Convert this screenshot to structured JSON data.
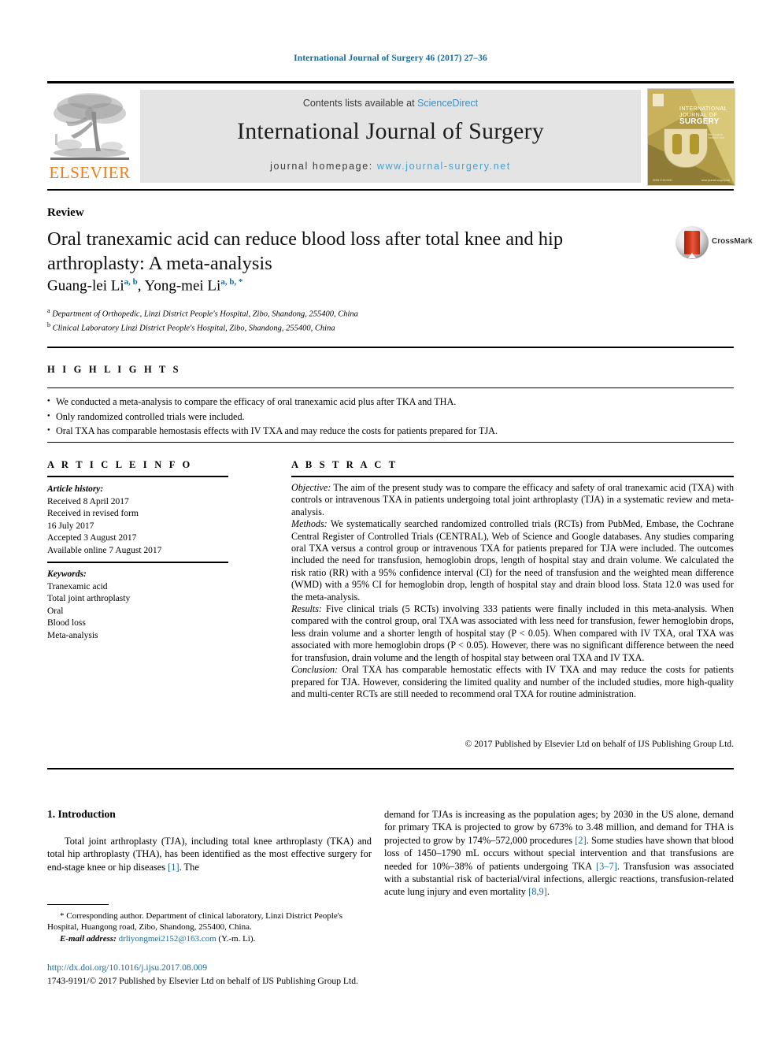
{
  "running_head": "International Journal of Surgery 46 (2017) 27–36",
  "masthead": {
    "contents_prefix": "Contents lists available at ",
    "contents_link": "ScienceDirect",
    "journal_title": "International Journal of Surgery",
    "homepage_prefix": "journal homepage: ",
    "homepage_url": "www.journal-surgery.net",
    "publisher_logo_text": "ELSEVIER",
    "cover": {
      "line1": "INTERNATIONAL",
      "line2": "JOURNAL OF",
      "line3": "SURGERY",
      "tagline": "The Official Journal of the Surgical Associates Ltd\nsurgical science and clinical practice",
      "foot_left": "ISSN 1743-9191",
      "foot_right": "www.journal-surgery.net"
    }
  },
  "article": {
    "type_kicker": "Review",
    "title": "Oral tranexamic acid can reduce blood loss after total knee and hip arthroplasty: A meta-analysis",
    "crossmark_label": "CrossMark",
    "authors": [
      {
        "name": "Guang-lei Li",
        "marks": "a, b"
      },
      {
        "name": "Yong-mei Li",
        "marks": "a, b, *"
      }
    ],
    "affiliations": [
      {
        "mark": "a",
        "text": "Department of Orthopedic, Linzi District People's Hospital, Zibo, Shandong, 255400, China"
      },
      {
        "mark": "b",
        "text": "Clinical Laboratory Linzi District People's Hospital, Zibo, Shandong, 255400, China"
      }
    ]
  },
  "highlights": {
    "heading": "H I G H L I G H T S",
    "items": [
      "We conducted a meta-analysis to compare the efficacy of oral tranexamic acid plus after TKA and THA.",
      "Only randomized controlled trials were included.",
      "Oral TXA has comparable hemostasis effects with IV TXA and may reduce the costs for patients prepared for TJA."
    ]
  },
  "article_info": {
    "heading": "A R T I C L E  I N F O",
    "history_label": "Article history:",
    "history": [
      "Received 8 April 2017",
      "Received in revised form",
      "16 July 2017",
      "Accepted 3 August 2017",
      "Available online 7 August 2017"
    ],
    "keywords_label": "Keywords:",
    "keywords": [
      "Tranexamic acid",
      "Total joint arthroplasty",
      "Oral",
      "Blood loss",
      "Meta-analysis"
    ]
  },
  "abstract": {
    "heading": "A B S T R A C T",
    "objective_label": "Objective:",
    "objective_text": " The aim of the present study was to compare the efficacy and safety of oral tranexamic acid (TXA) with controls or intravenous TXA in patients undergoing total joint arthroplasty (TJA) in a systematic review and meta-analysis.",
    "methods_label": "Methods:",
    "methods_text": " We systematically searched randomized controlled trials (RCTs) from PubMed, Embase, the Cochrane Central Register of Controlled Trials (CENTRAL), Web of Science and Google databases. Any studies comparing oral TXA versus a control group or intravenous TXA for patients prepared for TJA were included. The outcomes included the need for transfusion, hemoglobin drops, length of hospital stay and drain volume. We calculated the risk ratio (RR) with a 95% confidence interval (CI) for the need of transfusion and the weighted mean difference (WMD) with a 95% CI for hemoglobin drop, length of hospital stay and drain blood loss. Stata 12.0 was used for the meta-analysis.",
    "results_label": "Results:",
    "results_text": " Five clinical trials (5 RCTs) involving 333 patients were finally included in this meta-analysis. When compared with the control group, oral TXA was associated with less need for transfusion, fewer hemoglobin drops, less drain volume and a shorter length of hospital stay (P < 0.05). When compared with IV TXA, oral TXA was associated with more hemoglobin drops (P < 0.05). However, there was no significant difference between the need for transfusion, drain volume and the length of hospital stay between oral TXA and IV TXA.",
    "conclusion_label": "Conclusion:",
    "conclusion_text": " Oral TXA has comparable hemostatic effects with IV TXA and may reduce the costs for patients prepared for TJA. However, considering the limited quality and number of the included studies, more high-quality and multi-center RCTs are still needed to recommend oral TXA for routine administration.",
    "copyright": "© 2017 Published by Elsevier Ltd on behalf of IJS Publishing Group Ltd."
  },
  "body": {
    "section_heading": "1. Introduction",
    "left_paragraph_a": "Total joint arthroplasty (TJA), including total knee arthroplasty (TKA) and total hip arthroplasty (THA), has been identified as the most effective surgery for end-stage knee or hip diseases ",
    "left_ref_1": "[1]",
    "left_paragraph_b": ". The",
    "right_paragraph_a": "demand for TJAs is increasing as the population ages; by 2030 in the US alone, demand for primary TKA is projected to grow by 673% to 3.48 million, and demand for THA is projected to grow by 174%–572,000 procedures ",
    "right_ref_2": "[2]",
    "right_paragraph_b": ". Some studies have shown that blood loss of 1450–1790 mL occurs without special intervention and that transfusions are needed for 10%–38% of patients undergoing TKA ",
    "right_ref_3": "[3–7]",
    "right_paragraph_c": ". Transfusion was associated with a substantial risk of bacterial/viral infections, allergic reactions, transfusion-related acute lung injury and even mortality ",
    "right_ref_4": "[8,9]",
    "right_paragraph_d": "."
  },
  "footnote": {
    "star": "*",
    "corresponding": " Corresponding author. Department of clinical laboratory, Linzi District People's Hospital, Huangong road, Zibo, Shandong, 255400, China.",
    "email_label": "E-mail address:",
    "email": "drliyongmei2152@163.com",
    "email_owner": " (Y.-m. Li).",
    "doi": "http://dx.doi.org/10.1016/j.ijsu.2017.08.009",
    "issn_line": "1743-9191/© 2017 Published by Elsevier Ltd on behalf of IJS Publishing Group Ltd."
  },
  "colors": {
    "link_blue": "#1a6a9a",
    "sciencedirect_blue": "#3d8fc0",
    "elsevier_orange": "#ef7d1a",
    "cover_gold": "#b09a46"
  }
}
